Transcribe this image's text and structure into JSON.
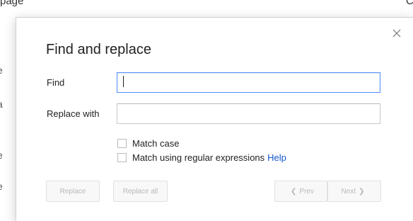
{
  "background": {
    "top_left_text": "page",
    "top_right_text": "C",
    "left_edge_fragments": [
      "e",
      "a",
      "e",
      "e",
      "I"
    ]
  },
  "dialog": {
    "title": "Find and replace",
    "close_icon": "close-icon",
    "find": {
      "label": "Find",
      "value": ""
    },
    "replace": {
      "label": "Replace with",
      "value": ""
    },
    "options": {
      "match_case": {
        "label": "Match case",
        "checked": false
      },
      "regex": {
        "label": "Match using regular expressions",
        "checked": false
      },
      "help_link": "Help"
    },
    "buttons": {
      "replace": "Replace",
      "replace_all": "Replace all",
      "prev": "Prev",
      "next": "Next"
    },
    "colors": {
      "focus_border": "#4d90fe",
      "link": "#1155cc",
      "disabled_text": "#b8b8b8"
    }
  }
}
